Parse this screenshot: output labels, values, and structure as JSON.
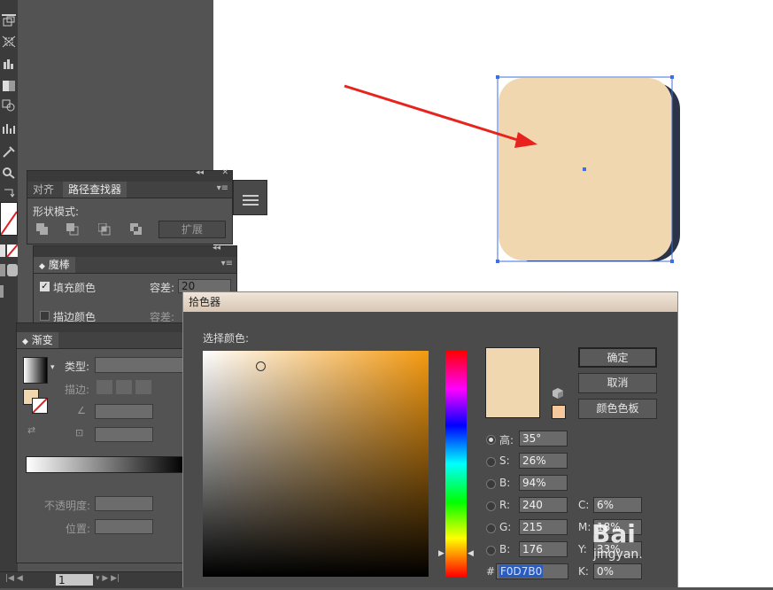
{
  "pathfinder_panel": {
    "tabs": [
      "对齐",
      "路径查找器"
    ],
    "shape_modes_label": "形状模式:",
    "expand_button": "扩展"
  },
  "magic_wand_panel": {
    "title": "魔棒",
    "fill_color_label": "填充颜色",
    "stroke_color_label": "描边颜色",
    "tolerance_label": "容差:",
    "tolerance_value": "20",
    "tolerance_label_2": "容差:"
  },
  "gradient_panel": {
    "title": "渐变",
    "type_label": "类型:",
    "stroke_label": "描边:",
    "opacity_label": "不透明度:",
    "position_label": "位置:"
  },
  "artboard": {
    "shape_fill": "#F0D7B0",
    "shadow_color": "#2a3347",
    "arrow_color": "#e8231d"
  },
  "color_picker": {
    "title": "拾色器",
    "select_color_label": "选择颜色:",
    "ok_button": "确定",
    "cancel_button": "取消",
    "swatches_button": "颜色色板",
    "current_color": "#F0D7B0",
    "web_color": "#F5C99C",
    "hsb": [
      {
        "label": "高:",
        "value": "35°",
        "selected": true
      },
      {
        "label": "S:",
        "value": "26%"
      },
      {
        "label": "B:",
        "value": "94%"
      }
    ],
    "rgb": [
      {
        "label": "R:",
        "value": "240"
      },
      {
        "label": "G:",
        "value": "215"
      },
      {
        "label": "B:",
        "value": "176"
      }
    ],
    "cmyk": [
      {
        "label": "C:",
        "value": "6%"
      },
      {
        "label": "M:",
        "value": "18%"
      },
      {
        "label": "Y:",
        "value": "33%"
      },
      {
        "label": "K:",
        "value": "0%"
      }
    ],
    "hex_label": "#",
    "hex_value": "F0D7B0"
  },
  "status_bar": {
    "page_number": "1"
  },
  "watermark": {
    "line1": "Bai",
    "line2": "jingyan."
  }
}
